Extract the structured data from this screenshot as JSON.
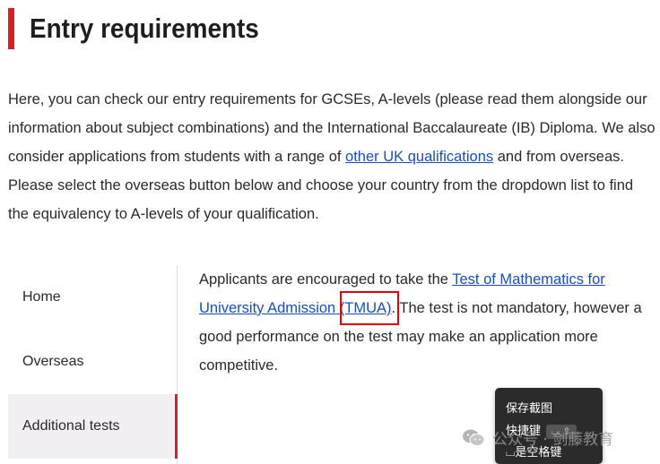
{
  "page": {
    "title": "Entry requirements",
    "intro": {
      "before_link": "Here, you can check our entry requirements for GCSEs, A-levels (please read them alongside our information about subject combinations) and the International Baccalaureate (IB) Diploma. We also consider applications from students with a range of ",
      "link_text": "other UK qualifications",
      "after_link": " and from overseas. Please select the overseas button below and choose your country from the dropdown list to find the equivalency to A-levels of your qualification."
    }
  },
  "tabs": {
    "items": [
      {
        "label": "Home",
        "active": false
      },
      {
        "label": "Overseas",
        "active": false
      },
      {
        "label": "Additional tests",
        "active": true
      }
    ],
    "active_color": "#d4202b"
  },
  "content": {
    "before_link": "Applicants are encouraged to take the ",
    "link_main": "Test of Mathematics for University Admission",
    "link_abbr": "(TMUA)",
    "after_link": ". The test is not mandatory, however a good performance on the test may make an application more competitive."
  },
  "annotation": {
    "highlight_color": "#e30000"
  },
  "context_menu": {
    "items": [
      "保存截图",
      "快捷键",
      "⌴是空格键"
    ],
    "shortcut_key": "⌴ ⇧"
  },
  "watermark": {
    "text": "公众号 · 剑藤教育",
    "icon": "wechat-icon"
  },
  "colors": {
    "accent": "#d4202b",
    "link": "#1a4fb8",
    "active_tab_bg": "#f2eff3"
  }
}
